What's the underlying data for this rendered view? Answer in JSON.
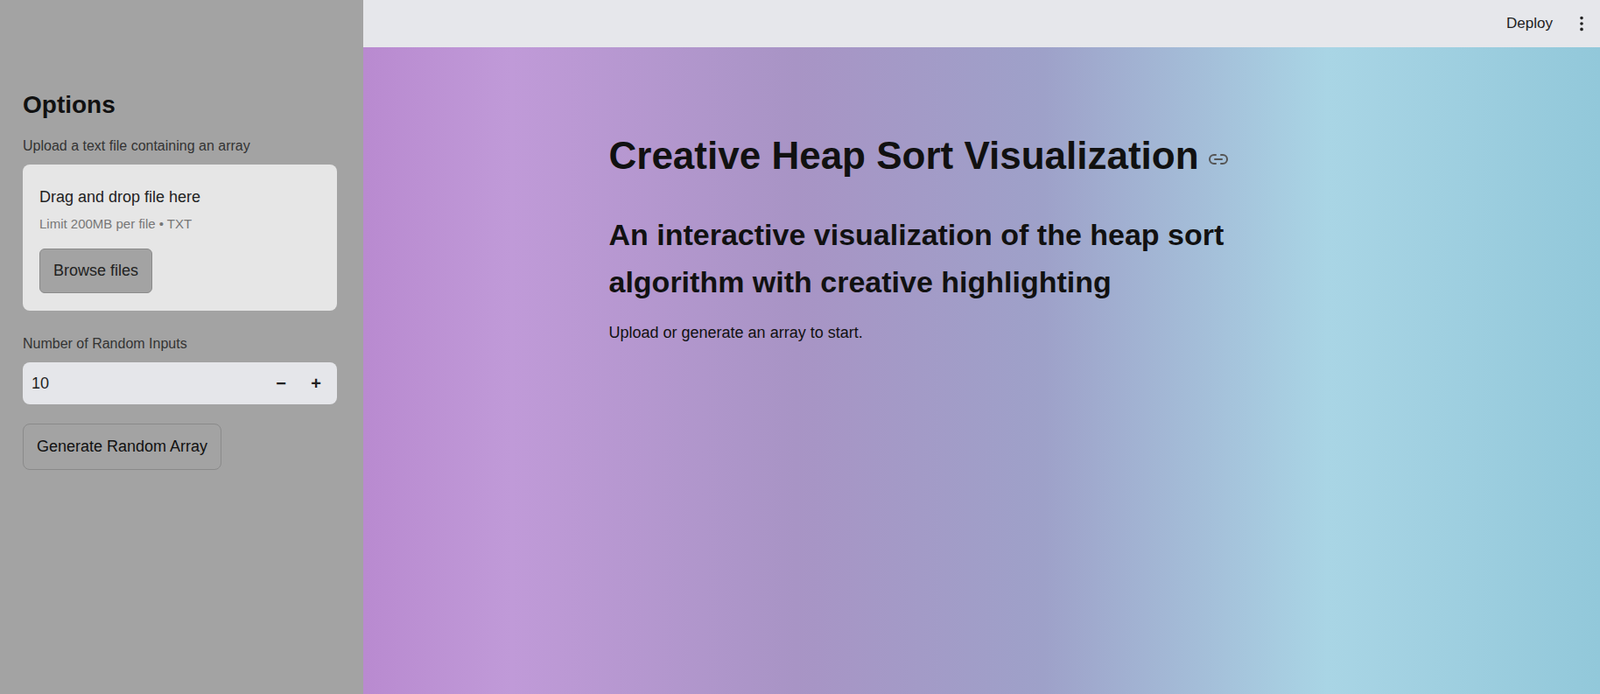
{
  "header": {
    "deploy": "Deploy"
  },
  "sidebar": {
    "title": "Options",
    "uploader": {
      "label": "Upload a text file containing an array",
      "drop_text": "Drag and drop file here",
      "limit": "Limit 200MB per file • TXT",
      "button": "Browse files"
    },
    "number_input": {
      "label": "Number of Random Inputs",
      "value": "10",
      "decrement": "−",
      "increment": "+"
    },
    "generate_button": "Generate Random Array"
  },
  "main": {
    "title": "Creative Heap Sort Visualization",
    "subtitle": "An interactive visualization of the heap sort algorithm with creative highlighting",
    "info": "Upload or generate an array to start."
  }
}
